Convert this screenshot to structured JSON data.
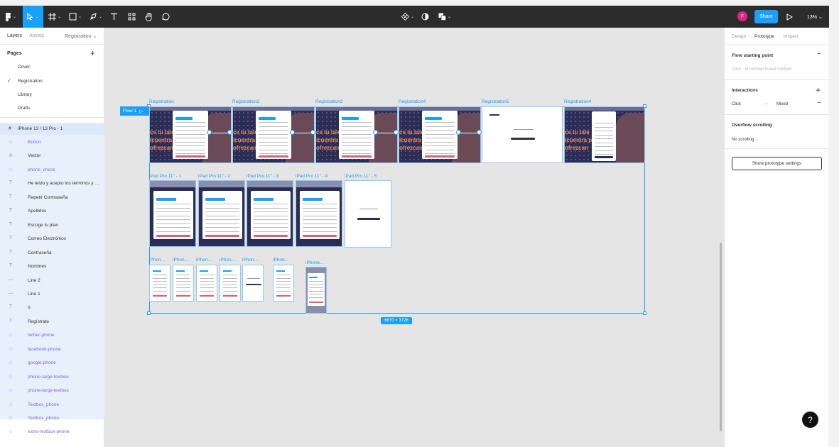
{
  "toolbar": {
    "share_label": "Share",
    "zoom": "13%",
    "avatar_initial": "F"
  },
  "left_panel": {
    "tabs": [
      "Layers",
      "Assets"
    ],
    "current_page": "Registration",
    "pages_header": "Pages",
    "pages": [
      "Cover",
      "Registration",
      "Library",
      "Drafts"
    ],
    "root_layer": "iPhone 13 / 13 Pro - 1",
    "layers": [
      {
        "label": "Button",
        "kind": "component"
      },
      {
        "label": "Vector",
        "kind": "vector"
      },
      {
        "label": "phone_check",
        "kind": "component"
      },
      {
        "label": "He leído y acepto los términos y condiciones",
        "kind": "text"
      },
      {
        "label": "Repetir Contraseña",
        "kind": "text"
      },
      {
        "label": "Apellidos",
        "kind": "text"
      },
      {
        "label": "Escoge tu plan",
        "kind": "text"
      },
      {
        "label": "Correo Electrónico",
        "kind": "text"
      },
      {
        "label": "Contraseña",
        "kind": "text"
      },
      {
        "label": "Nombres",
        "kind": "text"
      },
      {
        "label": "Line 2",
        "kind": "line"
      },
      {
        "label": "Line 1",
        "kind": "line"
      },
      {
        "label": "ó",
        "kind": "text"
      },
      {
        "label": "Regístrate",
        "kind": "text"
      },
      {
        "label": "twitter-phone",
        "kind": "component"
      },
      {
        "label": "facebook-phone",
        "kind": "component"
      },
      {
        "label": "google-phone",
        "kind": "component"
      },
      {
        "label": "phone-large-textbox",
        "kind": "component"
      },
      {
        "label": "phone-large-textbox",
        "kind": "component"
      },
      {
        "label": "Textbox_phone",
        "kind": "component"
      },
      {
        "label": "Textbox_phone",
        "kind": "component"
      },
      {
        "label": "icons-textbox-phone",
        "kind": "component"
      }
    ]
  },
  "canvas": {
    "flow_label": "Flow 1",
    "dimensions": "6870 × 3726",
    "desktop_frames": [
      "Registration",
      "Registration2",
      "Registration3",
      "Registration4",
      "Registration5",
      "Registration4"
    ],
    "tablet_frames": [
      "iPad Pro 11\" - 1",
      "iPad Pro 11\" - 2",
      "iPad Pro 11\" - 3",
      "iPad Pro 11\" - 4",
      "iPad Pro 11\" - 5"
    ],
    "phone_frames": [
      "iPhon...",
      "iPhon...",
      "iPhon...",
      "iPhon...",
      "iPhon...",
      "iPhon...",
      "iPhone..."
    ],
    "hero_text": [
      "ce tu tale",
      "icuentra p",
      "ofrezcan"
    ]
  },
  "right_panel": {
    "tabs": [
      "Design",
      "Prototype",
      "Inspect"
    ],
    "active_tab": "Prototype",
    "flow_start_title": "Flow starting point",
    "flow_start_hint": "Click - to remove mixed content.",
    "interactions_title": "Interactions",
    "interaction_trigger": "Click",
    "interaction_arrow": "→",
    "interaction_value": "Mixed",
    "overflow_title": "Overflow scrolling",
    "overflow_value": "No scrolling",
    "settings_button": "Show prototype settings"
  },
  "help_label": "?"
}
